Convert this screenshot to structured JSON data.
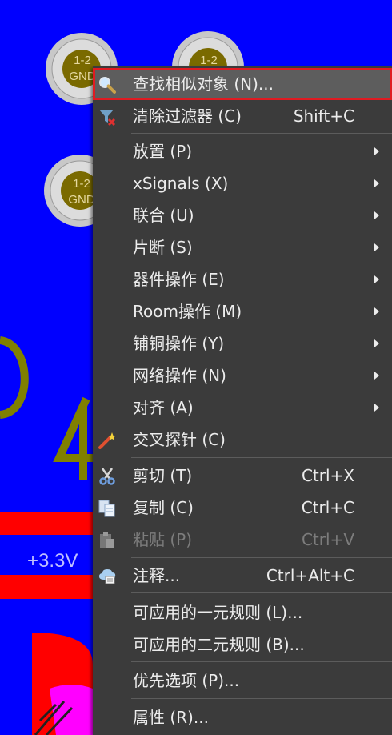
{
  "canvas": {
    "pad_label_top": "1-2",
    "pad_label_bottom": "GND",
    "net_label": "+3.3V",
    "colors": {
      "board": "#0000ff",
      "pad_ring": "#c8c8c8",
      "pad_core": "#7a6a00",
      "olive": "#808000",
      "red": "#ff0000",
      "magenta": "#ff00ff"
    }
  },
  "context_menu": {
    "items": [
      {
        "label": "查找相似对象 (N)...",
        "shortcut": "",
        "icon": "magnifier-icon",
        "submenu": false,
        "highlighted": true
      },
      {
        "label": "清除过滤器 (C)",
        "shortcut": "Shift+C",
        "icon": "clear-filter-icon",
        "submenu": false
      },
      {
        "label": "放置 (P)",
        "submenu": true
      },
      {
        "label": "xSignals (X)",
        "submenu": true
      },
      {
        "label": "联合 (U)",
        "submenu": true
      },
      {
        "label": "片断 (S)",
        "submenu": true
      },
      {
        "label": "器件操作 (E)",
        "submenu": true
      },
      {
        "label": "Room操作 (M)",
        "submenu": true
      },
      {
        "label": "铺铜操作 (Y)",
        "submenu": true
      },
      {
        "label": "网络操作 (N)",
        "submenu": true
      },
      {
        "label": "对齐 (A)",
        "submenu": true
      },
      {
        "label": "交叉探针 (C)",
        "icon": "magic-wand-icon",
        "submenu": false
      },
      {
        "label": "剪切 (T)",
        "shortcut": "Ctrl+X",
        "icon": "scissors-icon"
      },
      {
        "label": "复制 (C)",
        "shortcut": "Ctrl+C",
        "icon": "copy-icon"
      },
      {
        "label": "粘贴 (P)",
        "shortcut": "Ctrl+V",
        "icon": "paste-icon",
        "disabled": true
      },
      {
        "label": "注释...",
        "shortcut": "Ctrl+Alt+C",
        "icon": "comment-icon"
      },
      {
        "label": "可应用的一元规则 (L)..."
      },
      {
        "label": "可应用的二元规则 (B)..."
      },
      {
        "label": "优先选项 (P)..."
      },
      {
        "label": "属性 (R)..."
      }
    ]
  }
}
